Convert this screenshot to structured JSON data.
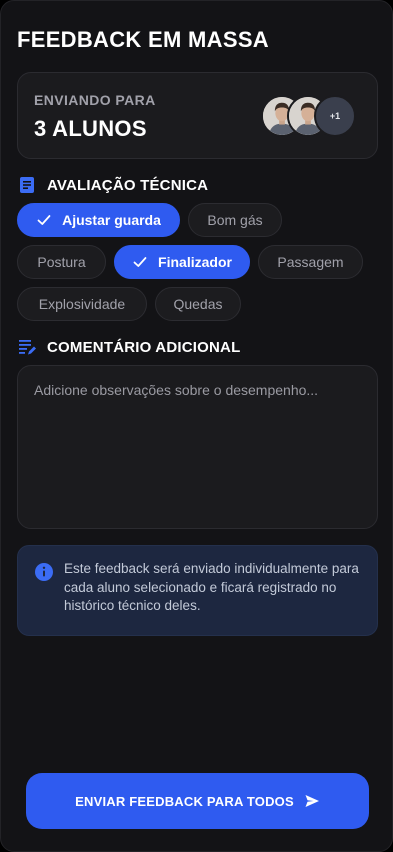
{
  "page": {
    "title": "FEEDBACK EM MASSA"
  },
  "recipients": {
    "label": "ENVIANDO PARA",
    "count_text": "3 ALUNOS",
    "more_badge": "+1"
  },
  "technical": {
    "heading": "AVALIAÇÃO TÉCNICA",
    "chips": [
      {
        "label": "Ajustar guarda",
        "selected": true
      },
      {
        "label": "Bom gás",
        "selected": false
      },
      {
        "label": "Postura",
        "selected": false
      },
      {
        "label": "Finalizador",
        "selected": true
      },
      {
        "label": "Passagem",
        "selected": false
      },
      {
        "label": "Explosividade",
        "selected": false
      },
      {
        "label": "Quedas",
        "selected": false
      }
    ]
  },
  "comment": {
    "heading": "COMENTÁRIO ADICIONAL",
    "placeholder": "Adicione observações sobre o desempenho...",
    "value": ""
  },
  "info": {
    "text": "Este feedback será enviado individualmente para cada aluno selecionado e ficará registrado no histórico técnico deles."
  },
  "actions": {
    "send_label": "ENVIAR FEEDBACK PARA TODOS"
  },
  "colors": {
    "accent": "#2f5bf0",
    "background": "#131316",
    "card": "#1b1b1e",
    "info_bg": "#1d2740"
  },
  "icons": {
    "section_technical": "document-icon",
    "section_comment": "edit-note-icon",
    "info": "info-icon",
    "send": "send-icon",
    "chip_selected": "check-icon"
  }
}
